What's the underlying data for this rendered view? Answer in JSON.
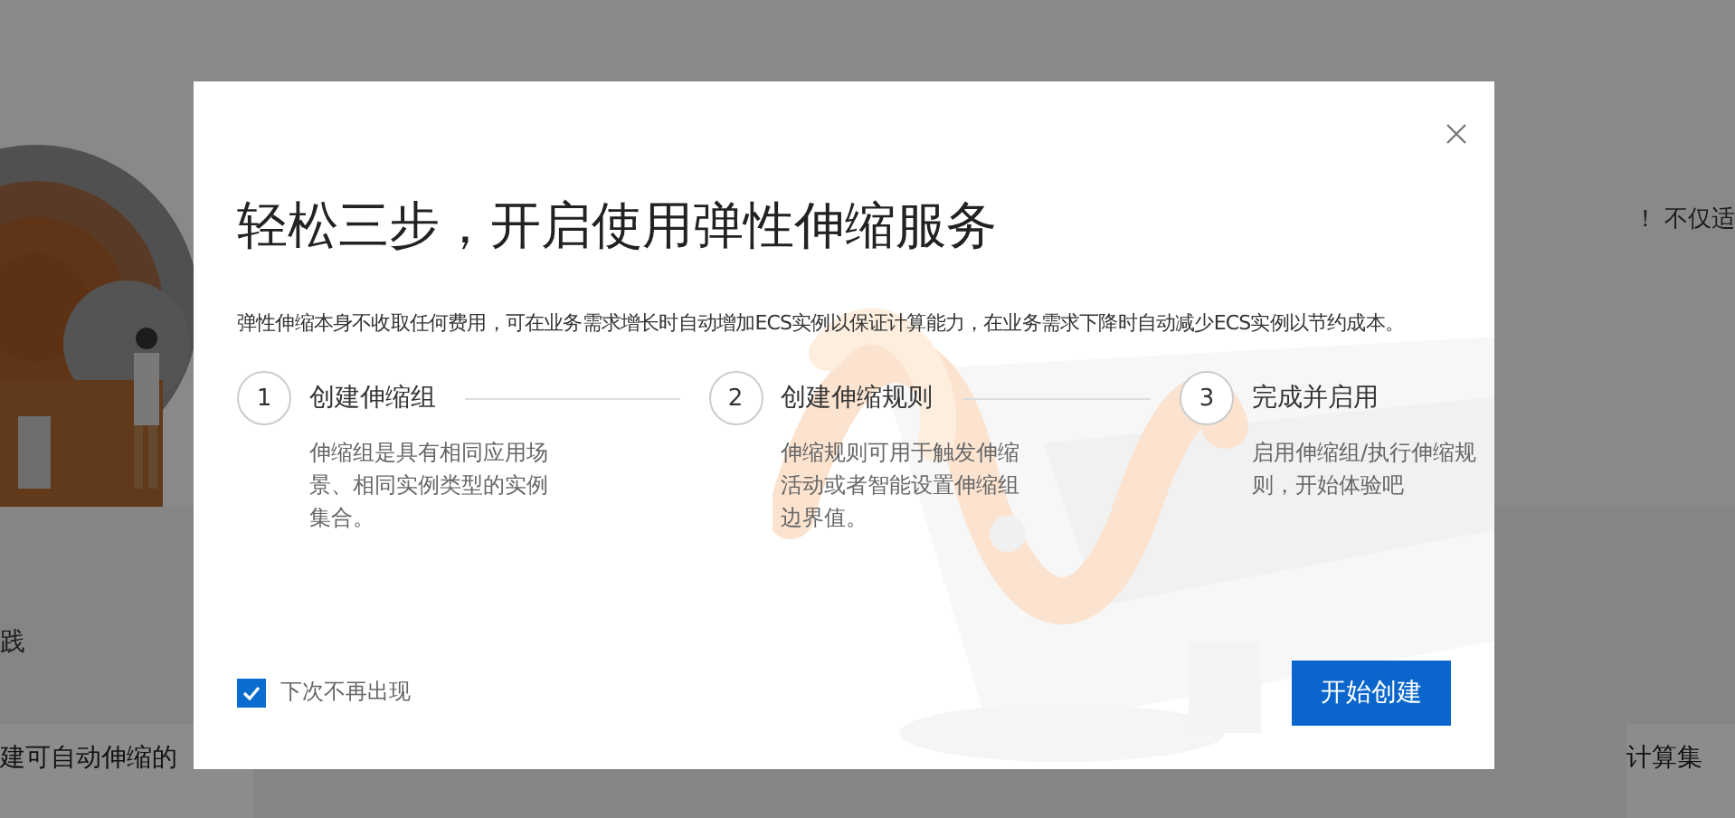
{
  "background": {
    "hero_text": "！ 不仅适",
    "section_title": "践",
    "card_titles": [
      "建可自动伸缩的",
      "计算集"
    ]
  },
  "dialog": {
    "title": "轻松三步，开启使用弹性伸缩服务",
    "description": "弹性伸缩本身不收取任何费用，可在业务需求增长时自动增加ECS实例以保证计算能力，在业务需求下降时自动减少ECS实例以节约成本。",
    "steps": [
      {
        "number": "1",
        "title": "创建伸缩组",
        "text": "伸缩组是具有相同应用场景、相同实例类型的实例集合。"
      },
      {
        "number": "2",
        "title": "创建伸缩规则",
        "text": "伸缩规则可用于触发伸缩活动或者智能设置伸缩组边界值。"
      },
      {
        "number": "3",
        "title": "完成并启用",
        "text": "启用伸缩组/执行伸缩规则，开始体验吧"
      }
    ],
    "dont_show_again": {
      "label": "下次不再出现",
      "checked": true
    },
    "primary_button": "开始创建"
  }
}
